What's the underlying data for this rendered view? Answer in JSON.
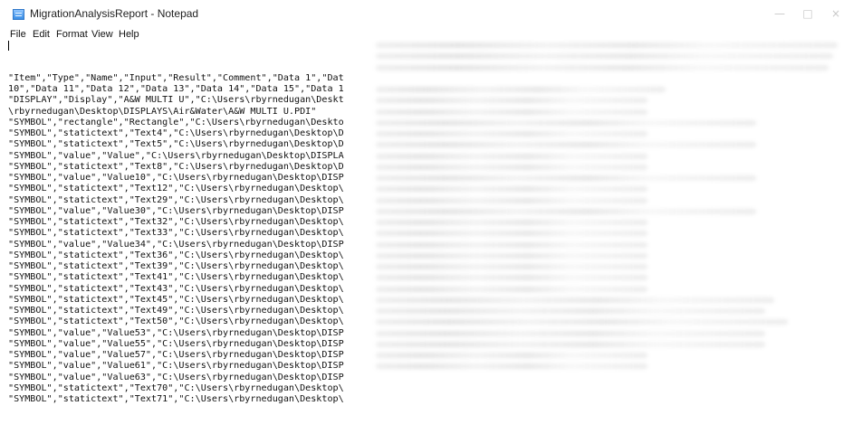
{
  "window": {
    "title": "MigrationAnalysisReport - Notepad"
  },
  "menu": {
    "items": [
      {
        "label": "File"
      },
      {
        "label": "Edit"
      },
      {
        "label": "Format"
      },
      {
        "label": "View"
      },
      {
        "label": "Help"
      }
    ]
  },
  "editor": {
    "lines": [
      {
        "text": "\"Item\",\"Type\",\"Name\",\"Input\",\"Result\",\"Comment\",\"Data 1\",\"Dat"
      },
      {
        "text": "10\",\"Data 11\",\"Data 12\",\"Data 13\",\"Data 14\",\"Data 15\",\"Data 1"
      },
      {
        "text": "\"DISPLAY\",\"Display\",\"A&W MULTI U\",\"C:\\Users\\rbyrnedugan\\Deskt"
      },
      {
        "text": "\\rbyrnedugan\\Desktop\\DISPLAYS\\Air&Water\\A&W MULTI U.PDI\""
      },
      {
        "text": "\"SYMBOL\",\"rectangle\",\"Rectangle\",\"C:\\Users\\rbyrnedugan\\Deskto"
      },
      {
        "text": "\"SYMBOL\",\"statictext\",\"Text4\",\"C:\\Users\\rbyrnedugan\\Desktop\\D"
      },
      {
        "text": "\"SYMBOL\",\"statictext\",\"Text5\",\"C:\\Users\\rbyrnedugan\\Desktop\\D"
      },
      {
        "text": "\"SYMBOL\",\"value\",\"Value\",\"C:\\Users\\rbyrnedugan\\Desktop\\DISPLA"
      },
      {
        "text": "\"SYMBOL\",\"statictext\",\"Text8\",\"C:\\Users\\rbyrnedugan\\Desktop\\D"
      },
      {
        "text": "\"SYMBOL\",\"value\",\"Value10\",\"C:\\Users\\rbyrnedugan\\Desktop\\DISP"
      },
      {
        "text": "\"SYMBOL\",\"statictext\",\"Text12\",\"C:\\Users\\rbyrnedugan\\Desktop\\"
      },
      {
        "text": "\"SYMBOL\",\"statictext\",\"Text29\",\"C:\\Users\\rbyrnedugan\\Desktop\\"
      },
      {
        "text": "\"SYMBOL\",\"value\",\"Value30\",\"C:\\Users\\rbyrnedugan\\Desktop\\DISP"
      },
      {
        "text": "\"SYMBOL\",\"statictext\",\"Text32\",\"C:\\Users\\rbyrnedugan\\Desktop\\"
      },
      {
        "text": "\"SYMBOL\",\"statictext\",\"Text33\",\"C:\\Users\\rbyrnedugan\\Desktop\\"
      },
      {
        "text": "\"SYMBOL\",\"value\",\"Value34\",\"C:\\Users\\rbyrnedugan\\Desktop\\DISP"
      },
      {
        "text": "\"SYMBOL\",\"statictext\",\"Text36\",\"C:\\Users\\rbyrnedugan\\Desktop\\"
      },
      {
        "text": "\"SYMBOL\",\"statictext\",\"Text39\",\"C:\\Users\\rbyrnedugan\\Desktop\\"
      },
      {
        "text": "\"SYMBOL\",\"statictext\",\"Text41\",\"C:\\Users\\rbyrnedugan\\Desktop\\"
      },
      {
        "text": "\"SYMBOL\",\"statictext\",\"Text43\",\"C:\\Users\\rbyrnedugan\\Desktop\\"
      },
      {
        "text": "\"SYMBOL\",\"statictext\",\"Text45\",\"C:\\Users\\rbyrnedugan\\Desktop\\"
      },
      {
        "text": "\"SYMBOL\",\"statictext\",\"Text49\",\"C:\\Users\\rbyrnedugan\\Desktop\\"
      },
      {
        "text": "\"SYMBOL\",\"statictext\",\"Text50\",\"C:\\Users\\rbyrnedugan\\Desktop\\"
      },
      {
        "text": "\"SYMBOL\",\"value\",\"Value53\",\"C:\\Users\\rbyrnedugan\\Desktop\\DISP"
      },
      {
        "text": "\"SYMBOL\",\"value\",\"Value55\",\"C:\\Users\\rbyrnedugan\\Desktop\\DISP"
      },
      {
        "text": "\"SYMBOL\",\"value\",\"Value57\",\"C:\\Users\\rbyrnedugan\\Desktop\\DISP"
      },
      {
        "text": "\"SYMBOL\",\"value\",\"Value61\",\"C:\\Users\\rbyrnedugan\\Desktop\\DISP"
      },
      {
        "text": "\"SYMBOL\",\"value\",\"Value63\",\"C:\\Users\\rbyrnedugan\\Desktop\\DISP"
      },
      {
        "text": "\"SYMBOL\",\"statictext\",\"Text70\",\"C:\\Users\\rbyrnedugan\\Desktop\\"
      },
      {
        "text": "\"SYMBOL\",\"statictext\",\"Text71\",\"C:\\Users\\rbyrnedugan\\Desktop\\"
      }
    ]
  }
}
